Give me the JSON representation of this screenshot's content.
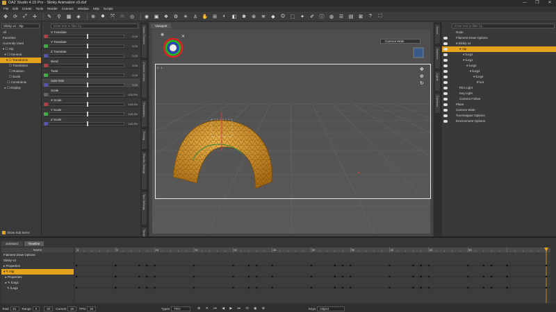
{
  "window": {
    "title": "DAZ Studio 4.15 Pro - Slinky Animation v3.duf",
    "controls": [
      "—",
      "❐",
      "✕"
    ]
  },
  "menubar": [
    "File",
    "Edit",
    "Create",
    "Tools",
    "Render",
    "Connect",
    "Window",
    "Help",
    "Scripts"
  ],
  "toolbar_icons": [
    "move-tool-icon",
    "rotate-tool-icon",
    "scale-tool-icon",
    "universal-tool-icon",
    "node-weight-icon",
    "joint-editor-icon",
    "geometry-editor-icon",
    "surface-selection-icon",
    "region-nav-icon",
    "active-pose-icon",
    "spot-render-icon",
    "render-icon",
    "render-settings-icon"
  ],
  "left_panel": {
    "figure_select": "Slinky v2 : Hip",
    "categories": [
      "All",
      "Favorites",
      "Currently Used"
    ],
    "tree": [
      {
        "label": "▾ ☐ Hip",
        "hl": false
      },
      {
        "label": "  ▾ ☐ General",
        "hl": false
      },
      {
        "label": "    ▾ ☐ Transforms",
        "hl": true
      },
      {
        "label": "       ☐ Translation",
        "hl": false
      },
      {
        "label": "       ☐ Rotation",
        "hl": false
      },
      {
        "label": "       ☐ Scale",
        "hl": false
      },
      {
        "label": "     ☐ Constraints",
        "hl": false
      },
      {
        "label": "  ▸ ☐ Display",
        "hl": false
      }
    ],
    "show_sub_items": "Show Sub Items"
  },
  "parameters": {
    "search_placeholder": "Enter text to filter by...",
    "items": [
      {
        "name": "X Translate",
        "value": "0.00",
        "lock": "red",
        "level": 0.5
      },
      {
        "name": "Y Translate",
        "value": "0.00",
        "lock": "green",
        "level": 0.5
      },
      {
        "name": "Z Translate",
        "value": "0.00",
        "lock": "blue",
        "level": 0.5
      },
      {
        "name": "Bend",
        "value": "0.00",
        "lock": "red",
        "level": 0.5
      },
      {
        "name": "Twist",
        "value": "0.00",
        "lock": "green",
        "level": 0.5
      },
      {
        "name": "Side-Side",
        "value": "0.00",
        "lock": "blue",
        "level": 0.5
      },
      {
        "name": "Scale",
        "value": "100.0%",
        "lock": "",
        "level": 0.5
      },
      {
        "name": "X Scale",
        "value": "100.0%",
        "lock": "red",
        "level": 0.5
      },
      {
        "name": "Y Scale",
        "value": "100.0%",
        "lock": "green",
        "level": 0.5
      },
      {
        "name": "Z Scale",
        "value": "100.0%",
        "lock": "blue",
        "level": 0.5
      }
    ]
  },
  "left_vtabs": [
    "Smart Content",
    "Content Library",
    "Parameters",
    "Posing",
    "Render Settings",
    "Tool Settings",
    "Timeline"
  ],
  "viewport": {
    "tab": "Viewport",
    "camera": "Camera Wide",
    "frame_label": "2 : 1"
  },
  "right_vtabs": [
    "Scene",
    "Surfaces",
    "Lights",
    "Cameras"
  ],
  "scene": {
    "search_placeholder": "Enter text to filter by...",
    "header": "Node",
    "nodes": [
      {
        "label": "Filament Draw Options",
        "indent": 0,
        "hl": false
      },
      {
        "label": "▾ Slinky v2",
        "indent": 0,
        "hl": false
      },
      {
        "label": "▾ Hip",
        "indent": 1,
        "hl": true
      },
      {
        "label": "▾ lLeg1",
        "indent": 2,
        "hl": false
      },
      {
        "label": "▾ lLeg1",
        "indent": 2,
        "hl": false
      },
      {
        "label": "▾ lLeg2",
        "indent": 3,
        "hl": false
      },
      {
        "label": "▾ lLeg3",
        "indent": 4,
        "hl": false
      },
      {
        "label": "▾ lLeg4",
        "indent": 5,
        "hl": false
      },
      {
        "label": "  lFoot",
        "indent": 6,
        "hl": false
      },
      {
        "label": "Rim Light",
        "indent": 1,
        "hl": false
      },
      {
        "label": "Key Light",
        "indent": 1,
        "hl": false
      },
      {
        "label": "Camera Follow",
        "indent": 1,
        "hl": false
      },
      {
        "label": "Plane",
        "indent": 0,
        "hl": false
      },
      {
        "label": "Camera Wide",
        "indent": 0,
        "hl": false
      },
      {
        "label": "Tonemapper Options",
        "indent": 0,
        "hl": false
      },
      {
        "label": "Environment Options",
        "indent": 0,
        "hl": false
      }
    ]
  },
  "timeline": {
    "tabs": [
      {
        "label": "aniMate2",
        "active": false
      },
      {
        "label": "Timeline",
        "active": true
      }
    ],
    "name_header": "Name",
    "rows": [
      {
        "label": "Filament Draw Options",
        "hl": false
      },
      {
        "label": "Slinky v2",
        "hl": false
      },
      {
        "label": "▸ Properties",
        "hl": false
      },
      {
        "label": "▾ ✎ Hip",
        "hl": true
      },
      {
        "label": "  ▸ Properties",
        "hl": false
      },
      {
        "label": "  ▸ ✎ lLeg1",
        "hl": false
      },
      {
        "label": "    ✎ lLeg1",
        "hl": false
      }
    ],
    "ruler_labels": [
      "0",
      "5",
      "10",
      "15",
      "20",
      "25",
      "30",
      "35",
      "40",
      "45",
      "50"
    ],
    "bottom_bar": {
      "total_label": "Total",
      "total": "61",
      "range_label": "Range",
      "range_start": "0",
      "range_end": "60",
      "current_label": "Current",
      "current": "60",
      "fps_label": "FPS",
      "fps": "30",
      "types_label": "Types",
      "types": "TRO",
      "keys_label": "Keys",
      "keys": "Object"
    }
  }
}
